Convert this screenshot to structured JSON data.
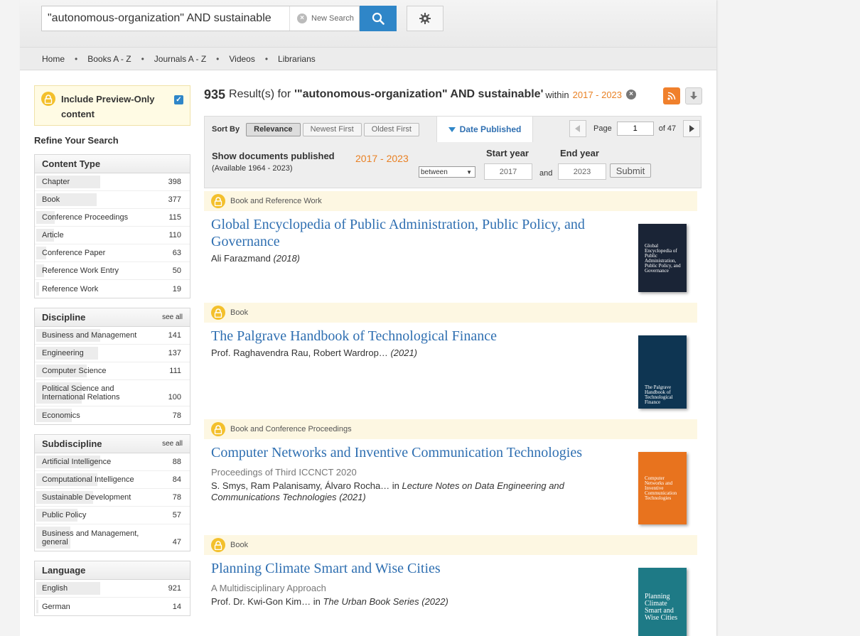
{
  "header": {
    "search_value": "\"autonomous-organization\" AND sustainable",
    "new_search": "New Search"
  },
  "nav": [
    "Home",
    "Books A - Z",
    "Journals A - Z",
    "Videos",
    "Librarians"
  ],
  "sidebar": {
    "preview_label": "Include Preview-Only content",
    "preview_checked": true,
    "refine_title": "Refine Your Search",
    "facets": [
      {
        "title": "Content Type",
        "see_all": "",
        "max": 398,
        "items": [
          {
            "label": "Chapter",
            "count": "398",
            "value": 398
          },
          {
            "label": "Book",
            "count": "377",
            "value": 377
          },
          {
            "label": "Conference Proceedings",
            "count": "115",
            "value": 115
          },
          {
            "label": "Article",
            "count": "110",
            "value": 110
          },
          {
            "label": "Conference Paper",
            "count": "63",
            "value": 63
          },
          {
            "label": "Reference Work Entry",
            "count": "50",
            "value": 50
          },
          {
            "label": "Reference Work",
            "count": "19",
            "value": 19
          }
        ]
      },
      {
        "title": "Discipline",
        "see_all": "see all",
        "max": 141,
        "items": [
          {
            "label": "Business and Management",
            "count": "141",
            "value": 141
          },
          {
            "label": "Engineering",
            "count": "137",
            "value": 137
          },
          {
            "label": "Computer Science",
            "count": "111",
            "value": 111
          },
          {
            "label": "Political Science and International Relations",
            "count": "100",
            "value": 100
          },
          {
            "label": "Economics",
            "count": "78",
            "value": 78
          }
        ]
      },
      {
        "title": "Subdiscipline",
        "see_all": "see all",
        "max": 88,
        "items": [
          {
            "label": "Artificial Intelligence",
            "count": "88",
            "value": 88
          },
          {
            "label": "Computational Intelligence",
            "count": "84",
            "value": 84
          },
          {
            "label": "Sustainable Development",
            "count": "78",
            "value": 78
          },
          {
            "label": "Public Policy",
            "count": "57",
            "value": 57
          },
          {
            "label": "Business and Management, general",
            "count": "47",
            "value": 47
          }
        ]
      },
      {
        "title": "Language",
        "see_all": "",
        "max": 921,
        "items": [
          {
            "label": "English",
            "count": "921",
            "value": 921
          },
          {
            "label": "German",
            "count": "14",
            "value": 14
          }
        ]
      }
    ]
  },
  "results": {
    "count": "935",
    "results_for": "Result(s) for",
    "query": "'\"autonomous-organization\" AND sustainable'",
    "within": "within",
    "range": "2017 - 2023"
  },
  "sort": {
    "label": "Sort By",
    "options": [
      "Relevance",
      "Newest First",
      "Oldest First"
    ],
    "active": "Relevance",
    "date_published": "Date Published",
    "page_label": "Page",
    "page_value": "1",
    "of_pages": "of 47"
  },
  "date_filter": {
    "show_docs": "Show documents published",
    "available": "(Available 1964 - 2023)",
    "range": "2017 - 2023",
    "mode": "between",
    "start_label": "Start year",
    "end_label": "End year",
    "start": "2017",
    "end": "2023",
    "and": "and",
    "submit": "Submit"
  },
  "items": [
    {
      "type": "Book and Reference Work",
      "title": "Global Encyclopedia of Public Administration, Public Policy, and Governance",
      "subtitle": "",
      "authors": "Ali Farazmand",
      "series": "",
      "year": "(2018)",
      "cover_text": "Global Encyclopedia of Public Administration, Public Policy, and Governance",
      "cover_color": "#1a2436"
    },
    {
      "type": "Book",
      "title": "The Palgrave Handbook of Technological Finance",
      "subtitle": "",
      "authors": "Prof. Raghavendra Rau, Robert Wardrop…",
      "series": "",
      "year": "(2021)",
      "cover_text": "The Palgrave Handbook of Technological Finance",
      "cover_color": "#0e3552"
    },
    {
      "type": "Book and Conference Proceedings",
      "title": "Computer Networks and Inventive Communication Technologies",
      "subtitle": "Proceedings of Third ICCNCT 2020",
      "authors": "S. Smys, Ram Palanisamy, Álvaro Rocha…",
      "series": "Lecture Notes on Data Engineering and Communications Technologies",
      "year": "(2021)",
      "cover_text": "Computer Networks and Inventive Communication Technologies",
      "cover_color": "#e8731e"
    },
    {
      "type": "Book",
      "title": "Planning Climate Smart and Wise Cities",
      "subtitle": "A Multidisciplinary Approach",
      "authors": "Prof. Dr. Kwi-Gon Kim…",
      "series": "The Urban Book Series",
      "year": "(2022)",
      "cover_text": "Planning Climate Smart and Wise Cities",
      "cover_color": "#1e7a86"
    }
  ],
  "colors": {
    "accent": "#2f86c8",
    "orange": "#e98124",
    "link": "#2f6fb1",
    "lock": "#f3c02c"
  }
}
